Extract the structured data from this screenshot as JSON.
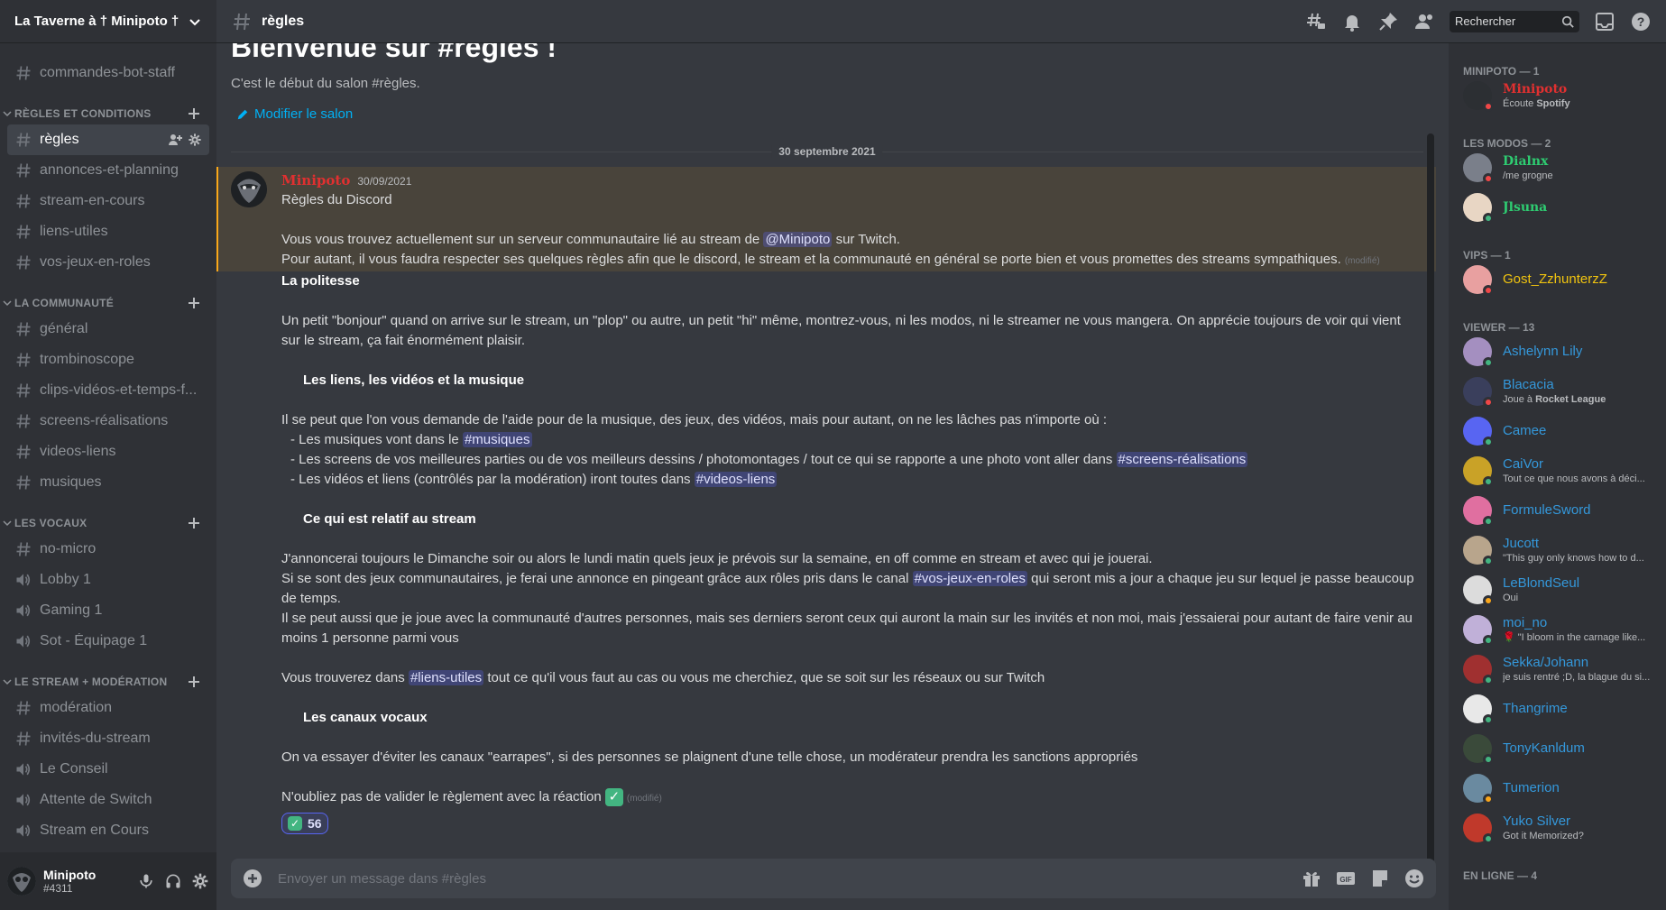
{
  "server": {
    "name": "La Taverne à † Minipoto †"
  },
  "channels": {
    "top": [
      {
        "name": "commandes-bot-staff",
        "type": "text"
      }
    ],
    "categories": [
      {
        "name": "RÈGLES ET CONDITIONS",
        "channels": [
          {
            "name": "règles",
            "type": "text",
            "active": true
          },
          {
            "name": "annonces-et-planning",
            "type": "text"
          },
          {
            "name": "stream-en-cours",
            "type": "text"
          },
          {
            "name": "liens-utiles",
            "type": "text"
          },
          {
            "name": "vos-jeux-en-roles",
            "type": "text"
          }
        ]
      },
      {
        "name": "LA COMMUNAUTÉ",
        "channels": [
          {
            "name": "général",
            "type": "text"
          },
          {
            "name": "trombinoscope",
            "type": "text"
          },
          {
            "name": "clips-vidéos-et-temps-f...",
            "type": "text"
          },
          {
            "name": "screens-réalisations",
            "type": "text"
          },
          {
            "name": "videos-liens",
            "type": "text"
          },
          {
            "name": "musiques",
            "type": "text"
          }
        ]
      },
      {
        "name": "LES VOCAUX",
        "channels": [
          {
            "name": "no-micro",
            "type": "text"
          },
          {
            "name": "Lobby 1",
            "type": "voice"
          },
          {
            "name": "Gaming 1",
            "type": "voice"
          },
          {
            "name": "Sot - Équipage 1",
            "type": "voice"
          }
        ]
      },
      {
        "name": "LE STREAM + MODÉRATION",
        "channels": [
          {
            "name": "modération",
            "type": "text"
          },
          {
            "name": "invités-du-stream",
            "type": "text"
          },
          {
            "name": "Le Conseil",
            "type": "voice"
          },
          {
            "name": "Attente de Switch",
            "type": "voice"
          },
          {
            "name": "Stream en Cours",
            "type": "voice"
          }
        ]
      }
    ]
  },
  "user": {
    "name": "Minipoto",
    "tag": "#4311"
  },
  "header": {
    "channel": "règles",
    "search_placeholder": "Rechercher"
  },
  "chat": {
    "welcome_title": "Bienvenue sur #règles !",
    "welcome_sub": "C'est le début du salon #règles.",
    "edit_channel": "Modifier le salon",
    "date_divider": "30 septembre 2021",
    "message": {
      "author": "Minipoto",
      "timestamp": "30/09/2021",
      "edited": "(modifié)",
      "l1": "Règles du Discord",
      "l2a": "Vous vous trouvez actuellement sur un serveur communautaire lié au stream de",
      "l2m": "@Minipoto",
      "l2b": "sur Twitch.",
      "l3": "Pour autant, il vous faudra respecter ses quelques règles afin que le discord, le stream et la communauté en général se porte bien et vous promettes des streams sympathiques.",
      "h1": "La politesse",
      "p1": "Un petit \"bonjour\" quand on arrive sur le stream, un \"plop\" ou autre, un petit \"hi\" même, montrez-vous, ni les modos, ni le streamer ne vous mangera. On apprécie toujours de voir qui vient sur le stream, ça fait énormément plaisir.",
      "h2": "Les liens, les vidéos et la musique",
      "p2": "Il se peut que l'on vous demande de l'aide pour de la musique, des jeux, des vidéos, mais pour autant, on ne les lâches pas n'importe où :",
      "li1a": "- Les musiques vont dans le",
      "li1m": "#musiques",
      "li2a": "- Les screens de vos meilleures parties ou de vos meilleurs dessins / photomontages / tout ce qui se rapporte a une photo vont aller dans",
      "li2m": "#screens-réalisations",
      "li3a": "- Les vidéos et liens (contrôlés par la modération) iront toutes dans",
      "li3m": "#videos-liens",
      "h3": "Ce qui est relatif au stream",
      "p3a": "J'annoncerai toujours le Dimanche soir ou alors le lundi matin quels jeux je prévois sur la semaine, en off comme en stream et avec qui je jouerai.",
      "p3b1": "Si se sont des jeux communautaires, je ferai une annonce en pingeant grâce aux rôles pris dans le canal",
      "p3bm": "#vos-jeux-en-roles",
      "p3b2": "qui seront mis a jour a chaque jeu sur lequel je passe beaucoup de temps.",
      "p3c": "Il se peut aussi que je joue avec la communauté d'autres personnes, mais ses derniers seront ceux qui auront la main sur les invités et non moi, mais j'essaierai pour autant de faire venir au moins 1 personne parmi vous",
      "p4a": "Vous trouverez dans",
      "p4m": "#liens-utiles",
      "p4b": "tout ce qu'il vous faut au cas ou vous me cherchiez, que se soit sur les réseaux ou sur Twitch",
      "h4": "Les canaux vocaux",
      "p5": "On va essayer d'éviter les canaux \"earrapes\", si des personnes se plaignent d'une telle chose, un modérateur prendra les sanctions appropriés",
      "p6": "N'oubliez pas de valider le règlement avec la réaction",
      "reaction_count": "56"
    },
    "composer_placeholder": "Envoyer un message dans #règles"
  },
  "members": {
    "groups": [
      {
        "title": "MINIPOTO — 1",
        "items": [
          {
            "name": "Minipoto",
            "activity_prefix": "Écoute ",
            "activity_bold": "Spotify",
            "color": "#e03030",
            "gothic": true,
            "status": "#f04747",
            "avatar": "#2c2f33"
          }
        ]
      },
      {
        "title": "LES MODOS — 2",
        "items": [
          {
            "name": "Dialnx",
            "activity_prefix": "/me grogne",
            "activity_bold": "",
            "color": "#2ecc71",
            "gothic": true,
            "status": "#f04747",
            "avatar": "#7a7f8a"
          },
          {
            "name": "Jlsuna",
            "activity_prefix": "",
            "activity_bold": "",
            "color": "#2ecc71",
            "gothic": true,
            "status": "#43b581",
            "avatar": "#e8d6c4"
          }
        ]
      },
      {
        "title": "VIPS — 1",
        "items": [
          {
            "name": "Gost_ZzhunterzZ",
            "activity_prefix": "",
            "activity_bold": "",
            "color": "#f1c40f",
            "gothic": false,
            "status": "#f04747",
            "avatar": "#e8a0a0"
          }
        ]
      },
      {
        "title": "VIEWER — 13",
        "items": [
          {
            "name": "Ashelynn Lily",
            "activity_prefix": "",
            "activity_bold": "",
            "color": "#3498db",
            "status": "#43b581",
            "avatar": "#a48fc0"
          },
          {
            "name": "Blacacia",
            "activity_prefix": "Joue à ",
            "activity_bold": "Rocket League",
            "color": "#3498db",
            "status": "#f04747",
            "avatar": "#3a3f5c"
          },
          {
            "name": "Camee",
            "activity_prefix": "",
            "activity_bold": "",
            "color": "#3498db",
            "status": "#43b581",
            "avatar": "#5865f2"
          },
          {
            "name": "CaiVor",
            "activity_prefix": "Tout ce que nous avons à déci...",
            "activity_bold": "",
            "color": "#3498db",
            "status": "#43b581",
            "avatar": "#c9a227"
          },
          {
            "name": "FormuleSword",
            "activity_prefix": "",
            "activity_bold": "",
            "color": "#3498db",
            "status": "#43b581",
            "avatar": "#e06fa0"
          },
          {
            "name": "Jucott",
            "activity_prefix": "\"This guy only knows how to d...",
            "activity_bold": "",
            "color": "#3498db",
            "status": "#43b581",
            "avatar": "#b8a58c"
          },
          {
            "name": "LeBlondSeul",
            "activity_prefix": "Oui",
            "activity_bold": "",
            "color": "#3498db",
            "status": "#faa61a",
            "avatar": "#dcdcdc"
          },
          {
            "name": "moi_no",
            "activity_prefix": "🌹 \"I bloom in the carnage like...",
            "activity_bold": "",
            "color": "#3498db",
            "status": "#43b581",
            "avatar": "#c0b0d8"
          },
          {
            "name": "Sekka/Johann",
            "activity_prefix": "je suis rentré ;D, la blague du si...",
            "activity_bold": "",
            "color": "#3498db",
            "status": "#43b581",
            "avatar": "#a03030"
          },
          {
            "name": "Thangrime",
            "activity_prefix": "",
            "activity_bold": "",
            "color": "#3498db",
            "status": "#43b581",
            "avatar": "#e8e8e8"
          },
          {
            "name": "TonyKanldum",
            "activity_prefix": "",
            "activity_bold": "",
            "color": "#3498db",
            "status": "#43b581",
            "avatar": "#3a4a3a"
          },
          {
            "name": "Tumerion",
            "activity_prefix": "",
            "activity_bold": "",
            "color": "#3498db",
            "status": "#faa61a",
            "avatar": "#6a8aa0"
          },
          {
            "name": "Yuko Silver",
            "activity_prefix": "Got it Memorized?",
            "activity_bold": "",
            "color": "#3498db",
            "status": "#43b581",
            "avatar": "#c0392b"
          }
        ]
      },
      {
        "title": "EN LIGNE — 4",
        "items": []
      }
    ]
  }
}
